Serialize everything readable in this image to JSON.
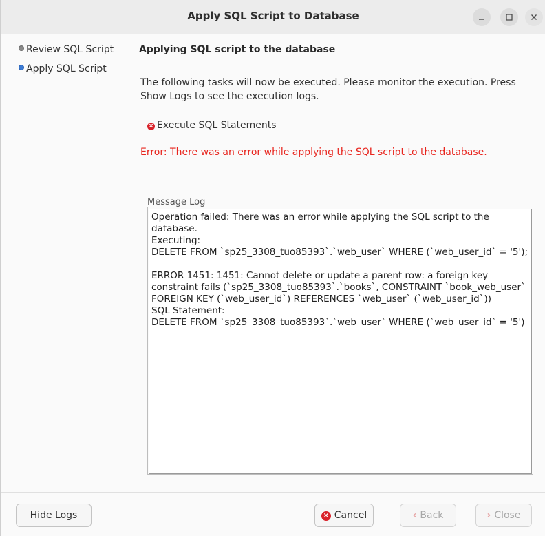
{
  "window": {
    "title": "Apply SQL Script to Database",
    "controls": {
      "minimize": "–",
      "maximize": "□",
      "close": "×"
    }
  },
  "sidebar": {
    "steps": [
      {
        "label": "Review SQL Script",
        "state": "done"
      },
      {
        "label": "Apply SQL Script",
        "state": "active"
      }
    ]
  },
  "main": {
    "heading": "Applying SQL script to the database",
    "description": "The following tasks will now be executed. Please monitor the execution. Press Show Logs to see the execution logs.",
    "task": {
      "icon": "error-circle-icon",
      "label": "Execute SQL Statements"
    },
    "error": "Error: There was an error while applying the SQL script to the database.",
    "log": {
      "label": "Message Log",
      "text": "Operation failed: There was an error while applying the SQL script to the database.\nExecuting:\nDELETE FROM `sp25_3308_tuo85393`.`web_user` WHERE (`web_user_id` = '5');\n\nERROR 1451: 1451: Cannot delete or update a parent row: a foreign key constraint fails (`sp25_3308_tuo85393`.`books`, CONSTRAINT `book_web_user` FOREIGN KEY (`web_user_id`) REFERENCES `web_user` (`web_user_id`))\nSQL Statement:\nDELETE FROM `sp25_3308_tuo85393`.`web_user` WHERE (`web_user_id` = '5')"
    }
  },
  "footer": {
    "hide_logs": "Hide Logs",
    "cancel": "Cancel",
    "back": "Back",
    "close": "Close",
    "back_glyph": "‹",
    "close_glyph": "›",
    "cancel_glyph": "×"
  },
  "colors": {
    "error_text": "#e8251e",
    "active_step": "#3a7bd5",
    "cancel_icon": "#d9232b"
  }
}
